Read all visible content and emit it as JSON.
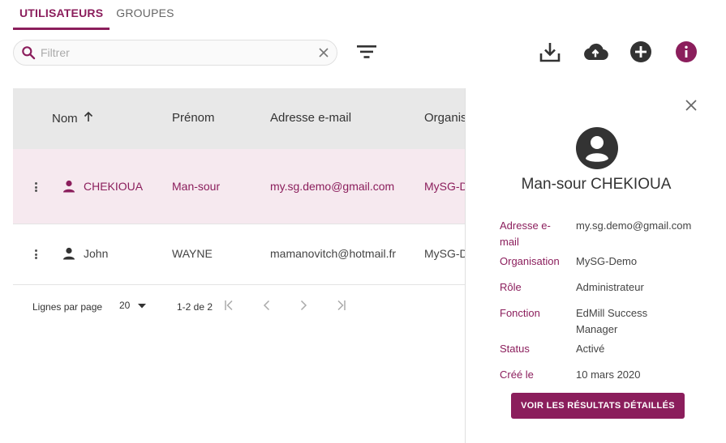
{
  "tabs": [
    {
      "label": "UTILISATEURS",
      "active": true
    },
    {
      "label": "GROUPES",
      "active": false
    }
  ],
  "search": {
    "placeholder": "Filtrer",
    "value": ""
  },
  "icons": {
    "search": "search-icon",
    "clear": "close-icon",
    "filter": "filter-list-icon",
    "download": "download-icon",
    "upload": "cloud-upload-icon",
    "add": "add-circle-icon",
    "info": "info-icon"
  },
  "colors": {
    "accent": "#8b1e5c",
    "header_bg": "#e8e8e8",
    "selected_row_bg": "#f6e9ef"
  },
  "table": {
    "columns": [
      {
        "label": "Nom",
        "sort": "ascending"
      },
      {
        "label": "Prénom"
      },
      {
        "label": "Adresse e-mail"
      },
      {
        "label": "Organisation"
      }
    ],
    "rows": [
      {
        "nom": "CHEKIOUA",
        "prenom": "Man-sour",
        "email": "my.sg.demo@gmail.com",
        "organisation": "MySG-Demo",
        "selected": true
      },
      {
        "nom": "John",
        "prenom": "WAYNE",
        "email": "mamanovitch@hotmail.fr",
        "organisation": "MySG-Demo",
        "selected": false
      }
    ]
  },
  "pager": {
    "rows_per_page_label": "Lignes par page",
    "rows_per_page": "20",
    "range": "1-2 de 2"
  },
  "panel": {
    "name": "Man-sour CHEKIOUA",
    "details": [
      {
        "label": "Adresse e-mail",
        "value": "my.sg.demo@gmail.com"
      },
      {
        "label": "Organisation",
        "value": "MySG-Demo"
      },
      {
        "label": "Rôle",
        "value": "Administrateur"
      },
      {
        "label": "Fonction",
        "value": "EdMill Success Manager"
      },
      {
        "label": "Status",
        "value": "Activé"
      },
      {
        "label": "Créé le",
        "value": "10 mars 2020"
      }
    ],
    "cta_label": "VOIR LES RÉSULTATS DÉTAILLÉS"
  }
}
